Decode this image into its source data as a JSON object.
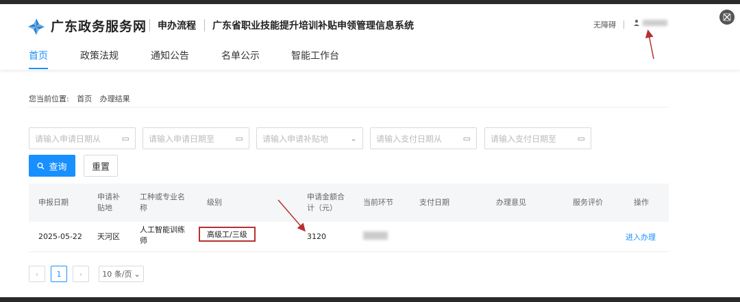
{
  "header": {
    "brand": "广东政务服务网",
    "flow": "申办流程",
    "system_title": "广东省职业技能提升培训补贴申领管理信息系统",
    "accessibility": "无障碍"
  },
  "nav": {
    "items": [
      {
        "label": "首页",
        "active": true
      },
      {
        "label": "政策法规",
        "active": false
      },
      {
        "label": "通知公告",
        "active": false
      },
      {
        "label": "名单公示",
        "active": false
      },
      {
        "label": "智能工作台",
        "active": false
      }
    ]
  },
  "breadcrumb": {
    "prefix": "您当前位置:",
    "home": "首页",
    "current": "办理结果"
  },
  "filters": {
    "apply_date_from": "请输入申请日期从",
    "apply_date_to": "请输入申请日期至",
    "apply_region": "请输入申请补贴地",
    "pay_date_from": "请输入支付日期从",
    "pay_date_to": "请输入支付日期至"
  },
  "buttons": {
    "search": "查询",
    "reset": "重置"
  },
  "table": {
    "headers": {
      "apply_date": "申报日期",
      "region": "申请补贴地",
      "trade": "工种或专业名称",
      "level": "级别",
      "amount": "申请金额合计（元）",
      "stage": "当前环节",
      "pay_date": "支付日期",
      "opinion": "办理意见",
      "rating": "服务评价",
      "operation": "操作"
    },
    "rows": [
      {
        "apply_date": "2025-05-22",
        "region": "天河区",
        "trade": "人工智能训练师",
        "level": "高级工/三级",
        "amount": "3120",
        "pay_date": "",
        "opinion": "",
        "rating": "",
        "operation": "进入办理"
      }
    ]
  },
  "pager": {
    "prev": "‹",
    "current_page": "1",
    "next": "›",
    "page_size": "10 条/页"
  },
  "colors": {
    "accent": "#1890ff",
    "highlight_border": "#b3312d"
  }
}
